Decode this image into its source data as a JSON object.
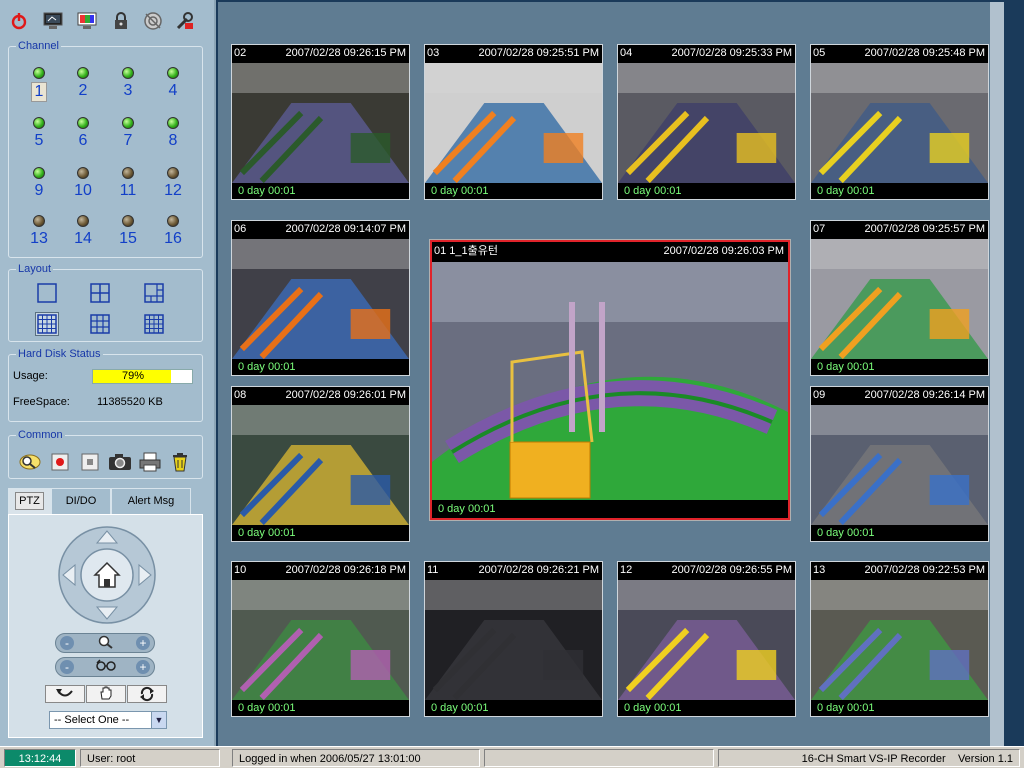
{
  "toolbar": {
    "icons": [
      "power-icon",
      "monitor-icon",
      "display-settings-icon",
      "lock-icon",
      "network-icon",
      "config-tools-icon"
    ]
  },
  "channel": {
    "title": "Channel",
    "items": [
      {
        "num": "1",
        "active": true,
        "selected": true
      },
      {
        "num": "2",
        "active": true
      },
      {
        "num": "3",
        "active": true
      },
      {
        "num": "4",
        "active": true
      },
      {
        "num": "5",
        "active": true
      },
      {
        "num": "6",
        "active": true
      },
      {
        "num": "7",
        "active": true
      },
      {
        "num": "8",
        "active": true
      },
      {
        "num": "9",
        "active": true
      },
      {
        "num": "10",
        "active": false
      },
      {
        "num": "11",
        "active": false
      },
      {
        "num": "12",
        "active": false
      },
      {
        "num": "13",
        "active": false
      },
      {
        "num": "14",
        "active": false
      },
      {
        "num": "15",
        "active": false
      },
      {
        "num": "16",
        "active": false
      }
    ]
  },
  "layout": {
    "title": "Layout",
    "options": [
      "layout-1x1-icon",
      "layout-2x2-icon",
      "layout-1plus5-icon",
      "layout-1plus12-icon",
      "layout-3x3-icon",
      "layout-4x4-icon"
    ],
    "selected_index": 3
  },
  "hdd": {
    "title": "Hard Disk Status",
    "usage_label": "Usage:",
    "usage_value": "79%",
    "usage_percent": 79,
    "free_label": "FreeSpace:",
    "free_value": "11385520 KB"
  },
  "common": {
    "title": "Common",
    "icons": [
      "search-playback-icon",
      "record-icon",
      "stop-icon",
      "snapshot-camera-icon",
      "print-icon",
      "delete-trash-icon"
    ]
  },
  "tabs": {
    "items": [
      "PTZ",
      "DI/DO",
      "Alert Msg"
    ],
    "active_index": 0
  },
  "ptz": {
    "zoom_minus": "-",
    "zoom_plus": "+",
    "focus_minus": "-",
    "focus_plus": "+",
    "select_value": "-- Select One --"
  },
  "cameras": [
    {
      "num": "02",
      "ts": "2007/02/28 09:26:15 PM",
      "footer": "0 day  00:01"
    },
    {
      "num": "03",
      "ts": "2007/02/28 09:25:51 PM",
      "footer": "0 day  00:01"
    },
    {
      "num": "04",
      "ts": "2007/02/28 09:25:33 PM",
      "footer": "0 day  00:01"
    },
    {
      "num": "05",
      "ts": "2007/02/28 09:25:48 PM",
      "footer": "0 day  00:01"
    },
    {
      "num": "06",
      "ts": "2007/02/28 09:14:07 PM",
      "footer": "0 day  00:01"
    },
    {
      "num": "07",
      "ts": "2007/02/28 09:25:57 PM",
      "footer": "0 day  00:01"
    },
    {
      "num": "08",
      "ts": "2007/02/28 09:26:01 PM",
      "footer": "0 day  00:01"
    },
    {
      "num": "09",
      "ts": "2007/02/28 09:26:14 PM",
      "footer": "0 day  00:01"
    },
    {
      "num": "10",
      "ts": "2007/02/28 09:26:18 PM",
      "footer": "0 day  00:01"
    },
    {
      "num": "11",
      "ts": "2007/02/28 09:26:21 PM",
      "footer": "0 day  00:01"
    },
    {
      "num": "12",
      "ts": "2007/02/28 09:26:55 PM",
      "footer": "0 day  00:01"
    },
    {
      "num": "13",
      "ts": "2007/02/28 09:22:53 PM",
      "footer": "0 day  00:01"
    }
  ],
  "main_camera": {
    "num": "01  1_1출유턴",
    "ts": "2007/02/28 09:26:03 PM",
    "footer": "0 day  00:01"
  },
  "status": {
    "clock": "13:12:44",
    "user": "User: root",
    "login": "Logged in when  2006/05/27 13:01:00",
    "product": "16-CH Smart VS-IP Recorder",
    "version": "Version 1.1"
  },
  "colors": {
    "selected_border": "#e0232a",
    "led_on": "#35b21c",
    "led_off": "#6e5b37",
    "usage_bar": "#ffff00",
    "clock_bg": "#0c8a6a"
  }
}
